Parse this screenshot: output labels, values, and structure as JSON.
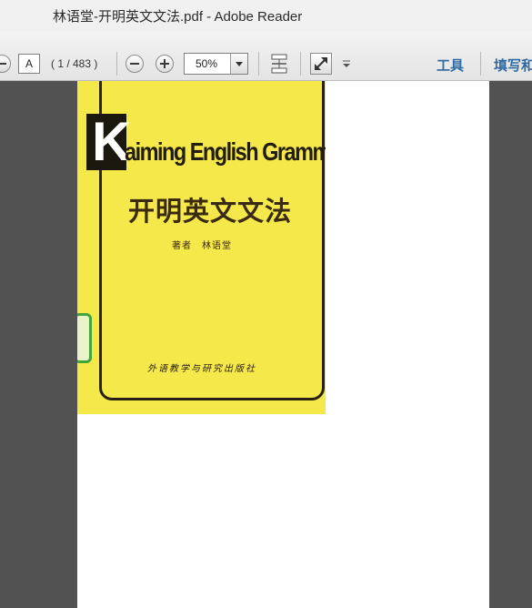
{
  "window": {
    "title": "林语堂-开明英文文法.pdf - Adobe Reader"
  },
  "toolbar": {
    "page_input_value": "A",
    "page_count": "( 1 / 483 )",
    "zoom_value": "50%",
    "tools_label": "工具",
    "sign_label": "填写和"
  },
  "cover": {
    "k_letter": "K",
    "english_title": "aiming English Grammar",
    "chinese_title": "开明英文文法",
    "author": "著者　林语堂",
    "publisher": "外语教学与研究出版社"
  },
  "colors": {
    "background": "#525252",
    "cover_yellow": "#f5e84a",
    "link_blue": "#2f6aa3",
    "tag_green": "#3fa53c"
  }
}
